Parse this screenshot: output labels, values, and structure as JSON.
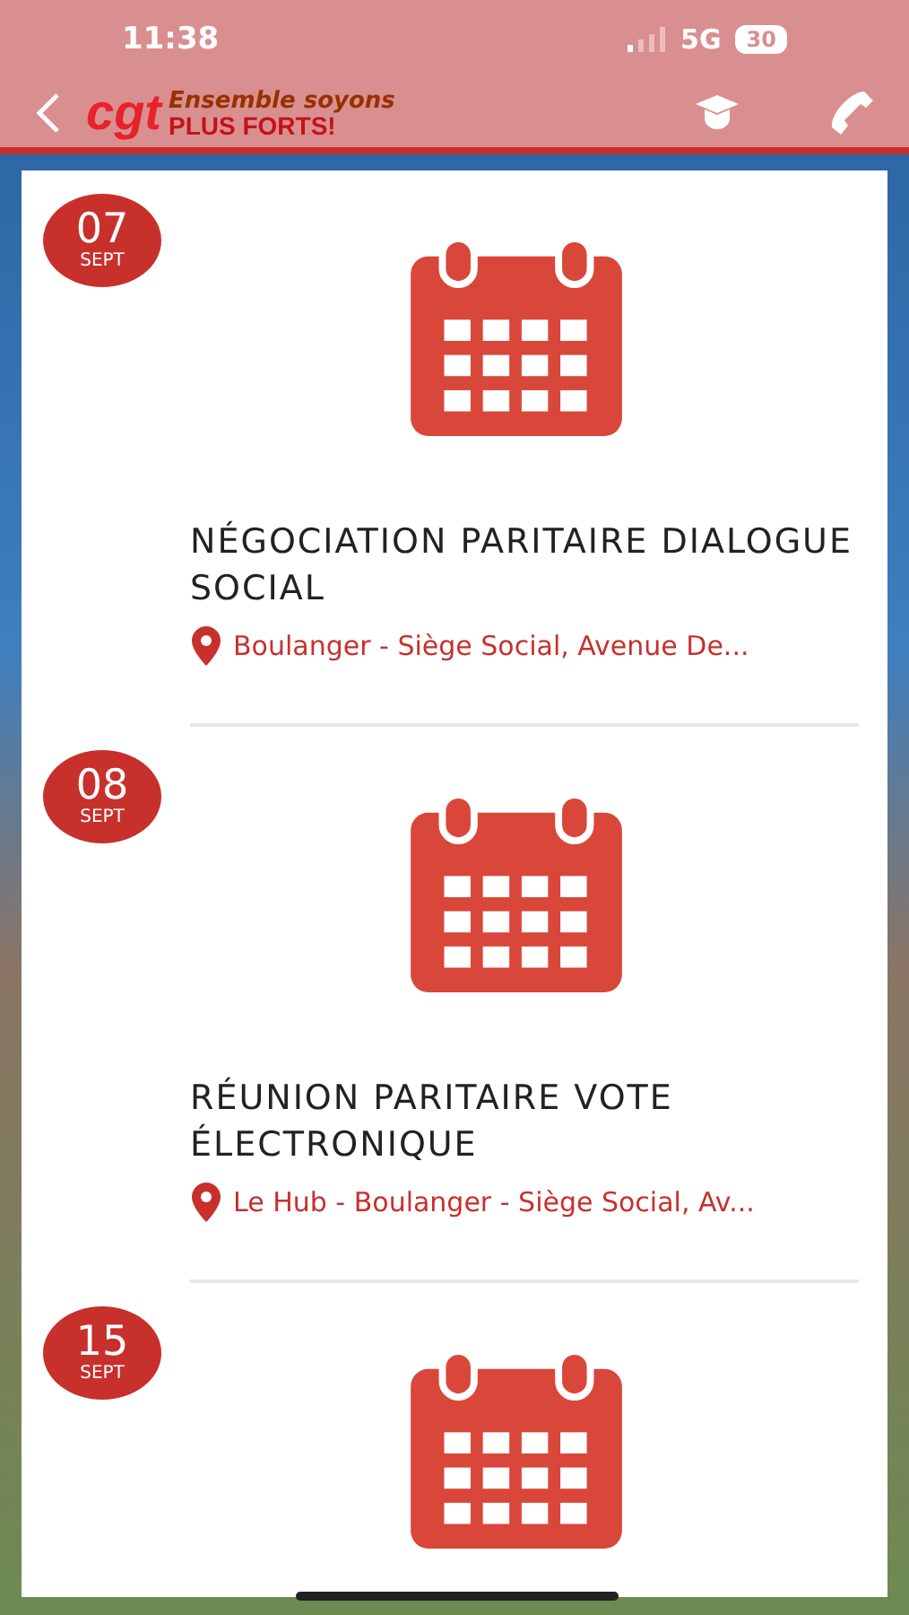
{
  "status_bar": {
    "time": "11:38",
    "network": "5G",
    "battery": "30"
  },
  "header": {
    "logo": {
      "mark": "cgt",
      "line_1": "Ensemble soyons",
      "line_2": "PLUS FORTS!"
    }
  },
  "events": [
    {
      "day": "07",
      "month": "SEPT",
      "title": "NÉGOCIATION PARITAIRE DIALOGUE SOCIAL",
      "location": "Boulanger - Siège Social, Avenue De..."
    },
    {
      "day": "08",
      "month": "SEPT",
      "title": "RÉUNION PARITAIRE VOTE ÉLECTRONIQUE",
      "location": "Le Hub - Boulanger - Siège Social, Av..."
    },
    {
      "day": "15",
      "month": "SEPT"
    }
  ]
}
